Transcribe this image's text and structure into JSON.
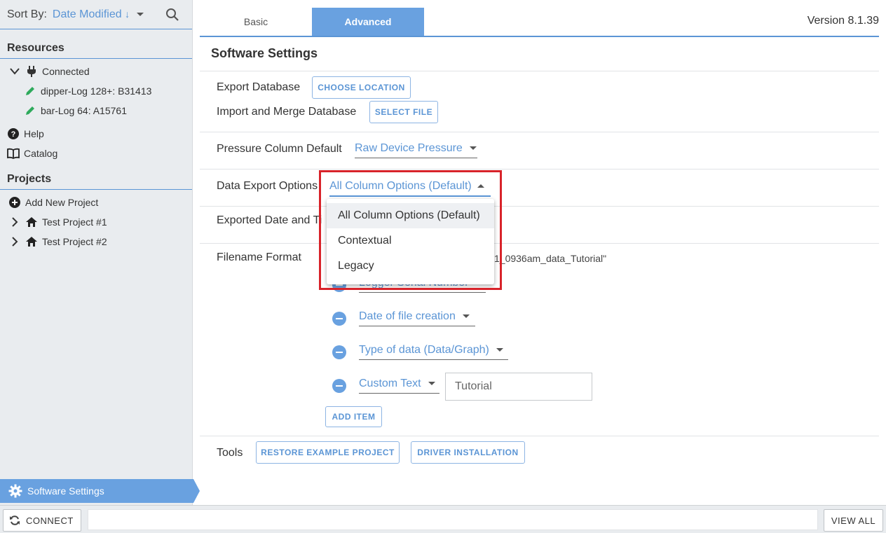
{
  "sidebar": {
    "sort_label": "Sort By:",
    "sort_value": "Date Modified",
    "sort_direction_glyph": "↓",
    "resources_heading": "Resources",
    "connected_label": "Connected",
    "devices": [
      {
        "label": "dipper-Log 128+: B31413"
      },
      {
        "label": "bar-Log 64: A15761"
      }
    ],
    "help_label": "Help",
    "catalog_label": "Catalog",
    "projects_heading": "Projects",
    "add_project_label": "Add New Project",
    "projects": [
      {
        "label": "Test Project #1"
      },
      {
        "label": "Test Project #2"
      }
    ],
    "settings_label": "Software Settings"
  },
  "tabs": {
    "basic": "Basic",
    "advanced": "Advanced",
    "active": "Advanced"
  },
  "version": "Version 8.1.39",
  "settings": {
    "title": "Software Settings",
    "export_db_label": "Export Database",
    "export_db_button": "CHOOSE LOCATION",
    "import_db_label": "Import and Merge Database",
    "import_db_button": "SELECT FILE",
    "pressure_label": "Pressure Column Default",
    "pressure_value": "Raw Device Pressure",
    "data_export_label": "Data Export Options",
    "data_export_value": "All Column Options (Default)",
    "data_export_options": [
      "All Column Options (Default)",
      "Contextual",
      "Legacy"
    ],
    "exported_date_label": "Exported Date and Ti",
    "filename_label": "Filename Format",
    "filename_example_fragment": "1_0936am_data_Tutorial\"",
    "filename_items": [
      {
        "label": "Logger Serial Number"
      },
      {
        "label": "Date of file creation"
      },
      {
        "label": "Type of data (Data/Graph)"
      },
      {
        "label": "Custom Text"
      }
    ],
    "custom_text_value": "Tutorial",
    "add_item_button": "ADD ITEM",
    "tools_label": "Tools",
    "restore_button": "RESTORE EXAMPLE PROJECT",
    "driver_button": "DRIVER INSTALLATION"
  },
  "bottom": {
    "connect_label": "CONNECT",
    "view_all_label": "VIEW ALL"
  },
  "colors": {
    "accent": "#5b95d5",
    "accent_fill": "#69a1e0",
    "device_pencil": "#2eaa5c",
    "highlight": "#d8232a"
  }
}
